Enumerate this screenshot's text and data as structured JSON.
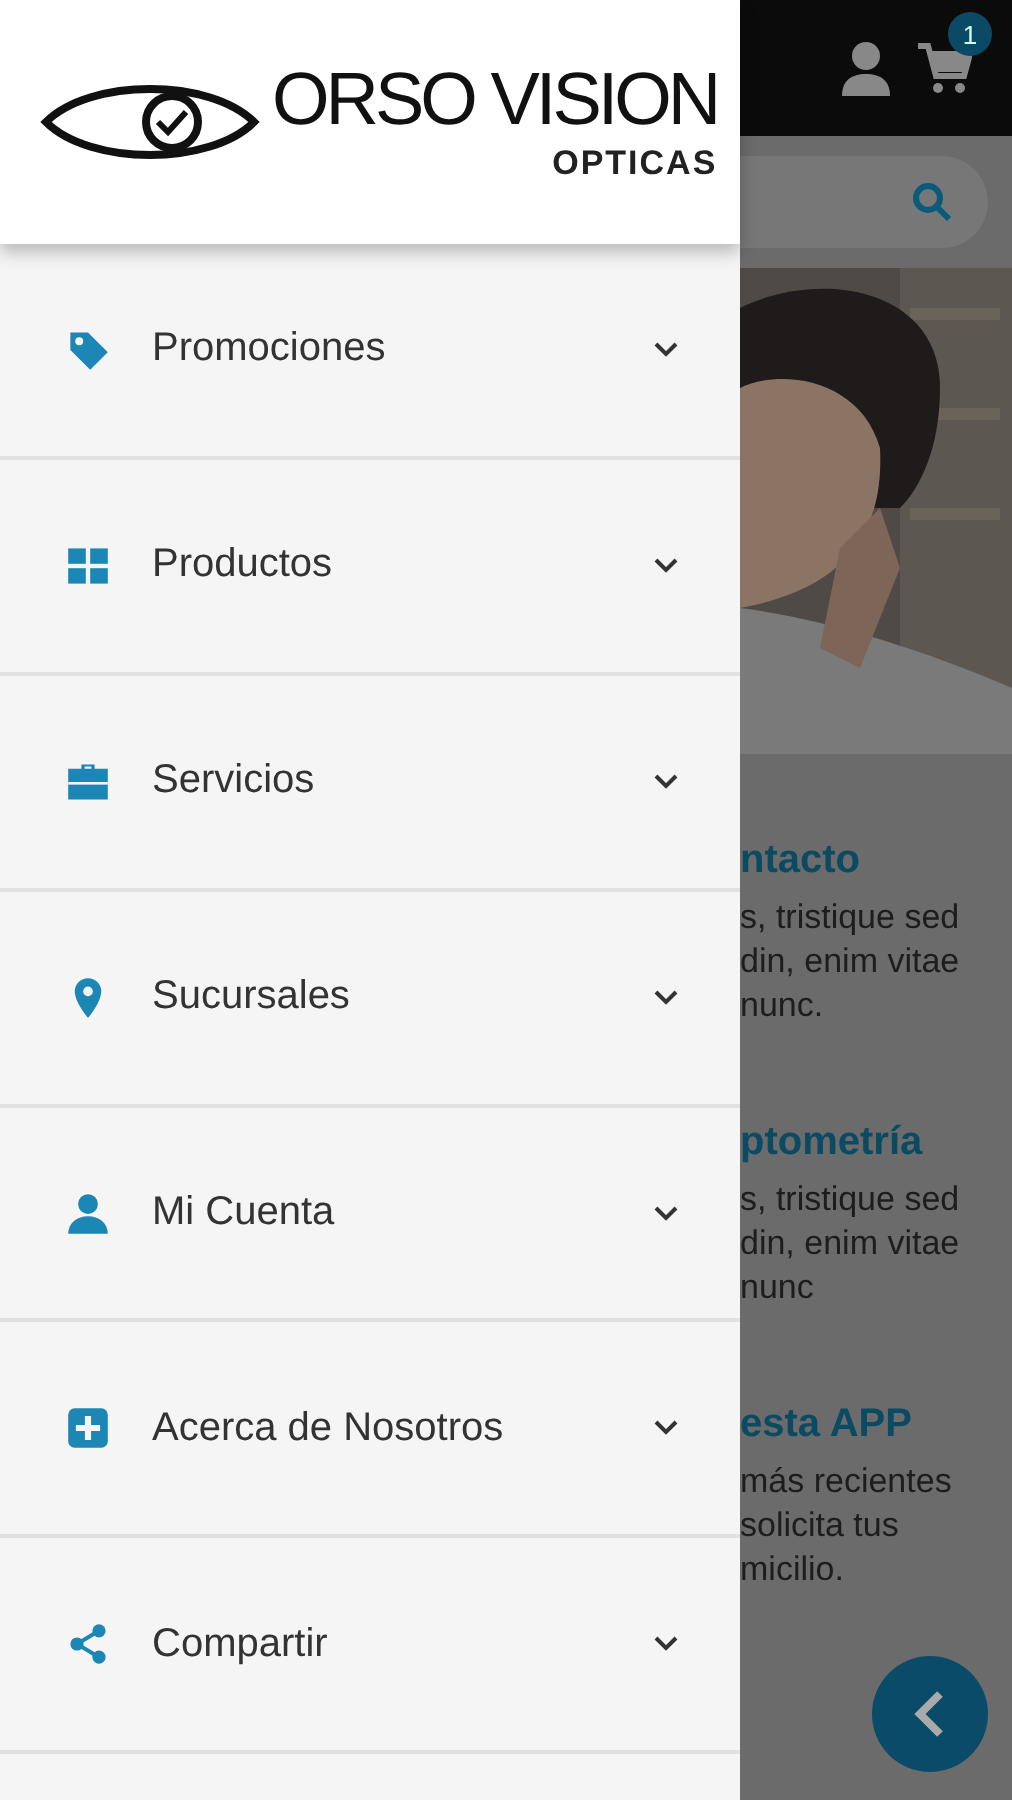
{
  "drawer": {
    "logo": {
      "brand": "ORSO VISION",
      "tagline": "OPTICAS"
    },
    "items": [
      {
        "label": "Promociones",
        "expanded": false
      },
      {
        "label": "Productos",
        "expanded": false
      },
      {
        "label": "Servicios",
        "expanded": false
      },
      {
        "label": "Sucursales",
        "expanded": false
      },
      {
        "label": "Mi Cuenta",
        "expanded": false
      },
      {
        "label": "Acerca de Nosotros",
        "expanded": false
      },
      {
        "label": "Compartir",
        "expanded": false
      }
    ]
  },
  "background": {
    "cart_badge": "1",
    "sections": [
      {
        "title": "ntacto",
        "lines": [
          "s, tristique sed",
          "din, enim vitae",
          "nunc."
        ]
      },
      {
        "title": "ptometría",
        "lines": [
          "s, tristique sed",
          "din, enim vitae",
          "nunc"
        ]
      },
      {
        "title": "esta APP",
        "lines": [
          "más recientes",
          "solicita tus",
          "micilio."
        ]
      }
    ]
  }
}
